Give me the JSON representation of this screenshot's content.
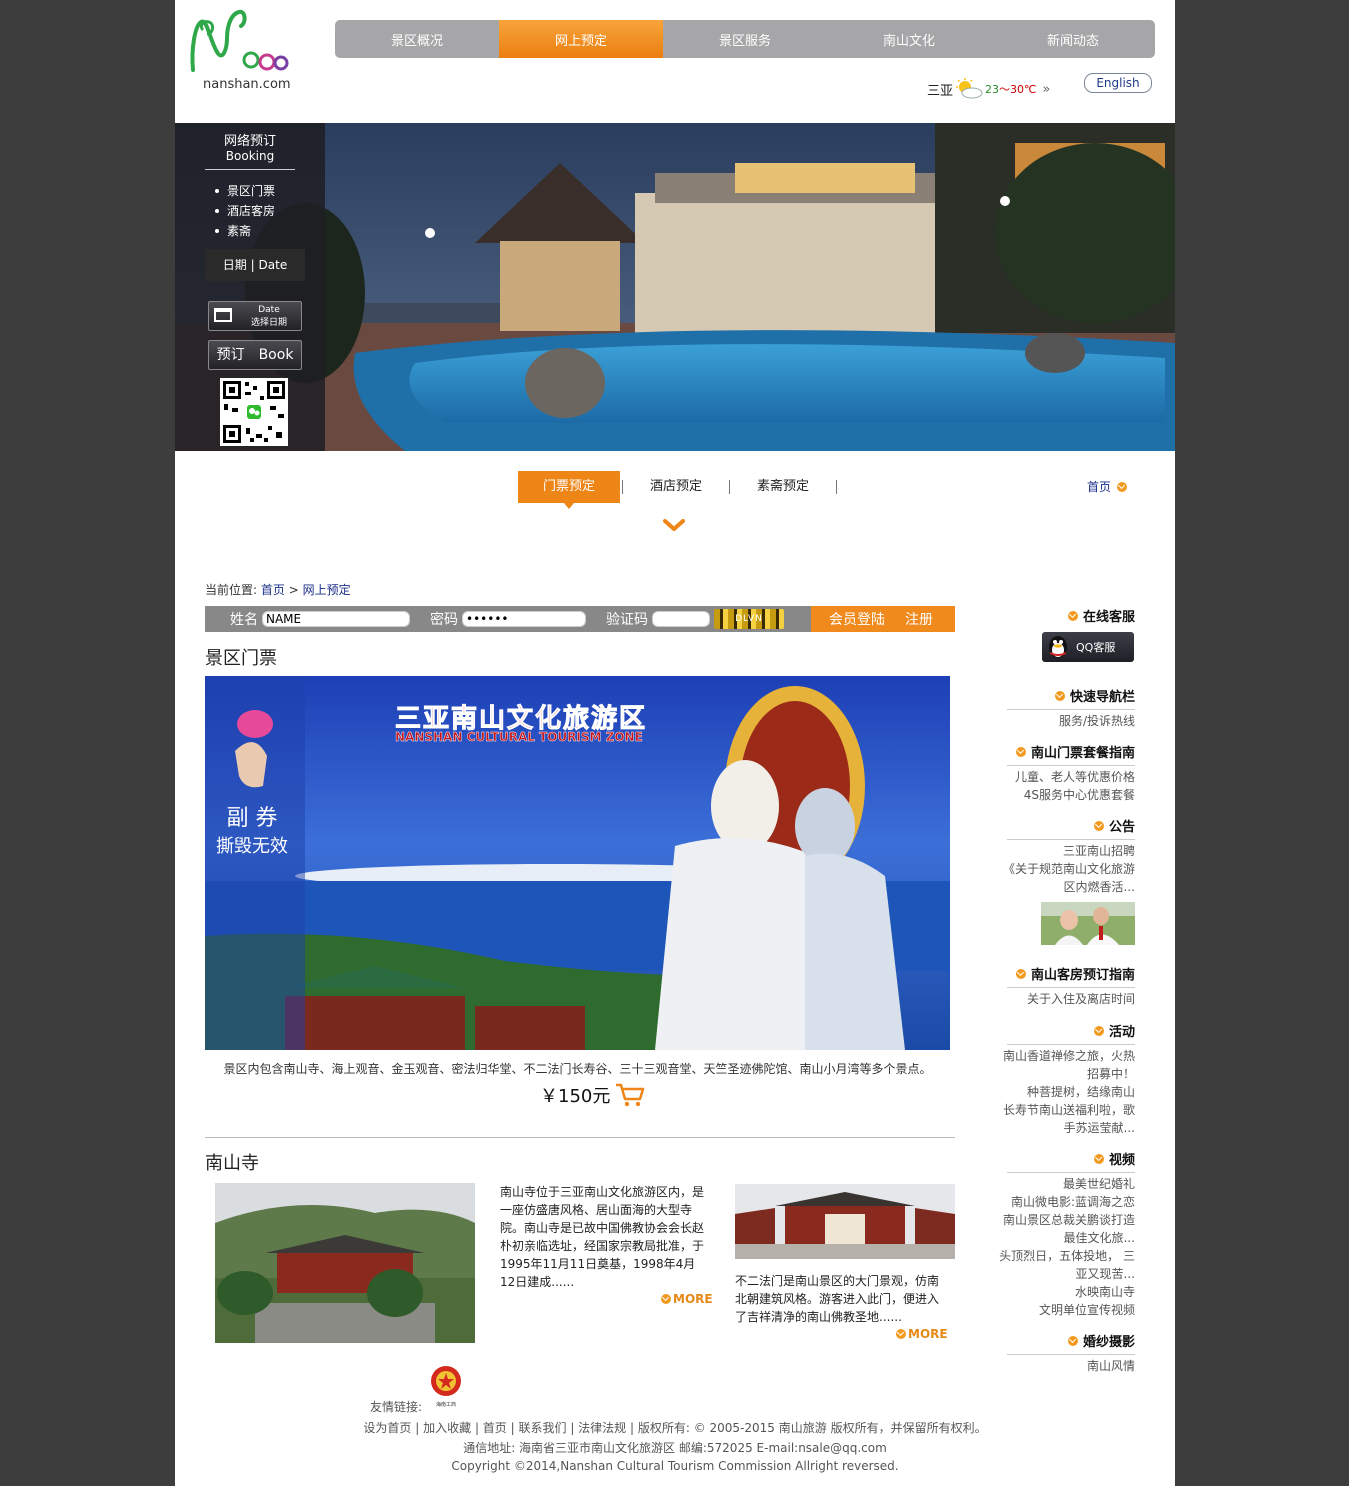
{
  "header": {
    "logo_site": "nanshan.com",
    "nav": [
      "景区概况",
      "网上预定",
      "景区服务",
      "南山文化",
      "新闻动态"
    ],
    "weather_city": "三亚",
    "weather_low": "23",
    "weather_tilde": "～",
    "weather_high": "30℃",
    "weather_arrow": "»",
    "english": "English"
  },
  "sidebar": {
    "title_cn": "网络预订",
    "title_en": "Booking",
    "items": [
      "景区门票",
      "酒店客房",
      "素斋"
    ],
    "date_label": "日期",
    "date_label_en": "Date",
    "date_btn_1": "Date",
    "date_btn_2": "选择日期",
    "book_btn": "预订　Book"
  },
  "tabs": [
    "门票预定",
    "酒店预定",
    "素斋预定"
  ],
  "home_link": "首页",
  "breadcrumb": {
    "label": "当前位置:",
    "home": "首页",
    "sep": ">",
    "current": "网上预定"
  },
  "login": {
    "name_label": "姓名",
    "name_value": "NAME",
    "pwd_label": "密码",
    "pwd_value": "••••••",
    "code_label": "验证码",
    "captcha": "DLVN",
    "login_btn": "会员登陆",
    "register_btn": "注册"
  },
  "ticket": {
    "title": "景区门票",
    "image_title_cn": "三亚南山文化旅游区",
    "image_title_en": "NANSHAN CULTURAL TOURISM ZONE",
    "stub_1": "副 券",
    "stub_2": "撕毁无效",
    "desc": "景区内包含南山寺、海上观音、金玉观音、密法归华堂、不二法门长寿谷、三十三观音堂、天竺圣迹佛陀馆、南山小月湾等多个景点。",
    "price": "￥150元"
  },
  "temple": {
    "title": "南山寺",
    "text1": "南山寺位于三亚南山文化旅游区内，是一座仿盛唐风格、居山面海的大型寺院。南山寺是已故中国佛教协会会长赵朴初亲临选址，经国家宗教局批准，于1995年11月11日奠基，1998年4月12日建成......",
    "more1": "MORE",
    "text2": "不二法门是南山景区的大门景观，仿南北朝建筑风格。游客进入此门，便进入了吉祥清净的南山佛教圣地......",
    "more2": "MORE"
  },
  "right": {
    "online_service": "在线客服",
    "qq": "QQ客服",
    "quick_nav": "快速导航栏",
    "quick_nav_items": [
      "服务/投诉热线"
    ],
    "ticket_guide": "南山门票套餐指南",
    "ticket_guide_items": [
      "儿童、老人等优惠价格",
      "4S服务中心优惠套餐"
    ],
    "notice": "公告",
    "notice_items": [
      "三亚南山招聘",
      "《关于规范南山文化旅游",
      "区内燃香活..."
    ],
    "room_guide": "南山客房预订指南",
    "room_guide_items": [
      "关于入住及离店时间"
    ],
    "activity": "活动",
    "activity_items": [
      "南山香道禅修之旅，火热",
      "招募中！",
      "种菩提树，结缘南山",
      "长寿节南山送福利啦，歌",
      "手苏运莹献..."
    ],
    "video": "视频",
    "video_items": [
      "最美世纪婚礼",
      "南山微电影:蓝调海之恋",
      "南山景区总裁关鹏谈打造",
      "最佳文化旅...",
      "头顶烈日，五体投地， 三",
      "亚又现苦...",
      "水映南山寺",
      "文明单位宣传视频"
    ],
    "wedding": "婚纱摄影",
    "wedding_items": [
      "南山风情"
    ]
  },
  "footer": {
    "friend": "友情链接:",
    "badge_text": "海南工商",
    "links": [
      "设为首页",
      "加入收藏",
      "首页",
      "联系我们",
      "法律法规"
    ],
    "copyright_cn": "版权所有: © 2005-2015 南山旅游 版权所有，并保留所有权利。",
    "address": "通信地址: 海南省三亚市南山文化旅游区 邮编:572025 E-mail:nsale@qq.com",
    "copyright_en": "Copyright ©2014,Nanshan Cultural Tourism Commission Allright reversed."
  },
  "colors": {
    "accent": "#ee8517",
    "nav_gray": "#a6a6a8",
    "link_blue": "#1a2f8a",
    "background": "#3d3d3d"
  }
}
